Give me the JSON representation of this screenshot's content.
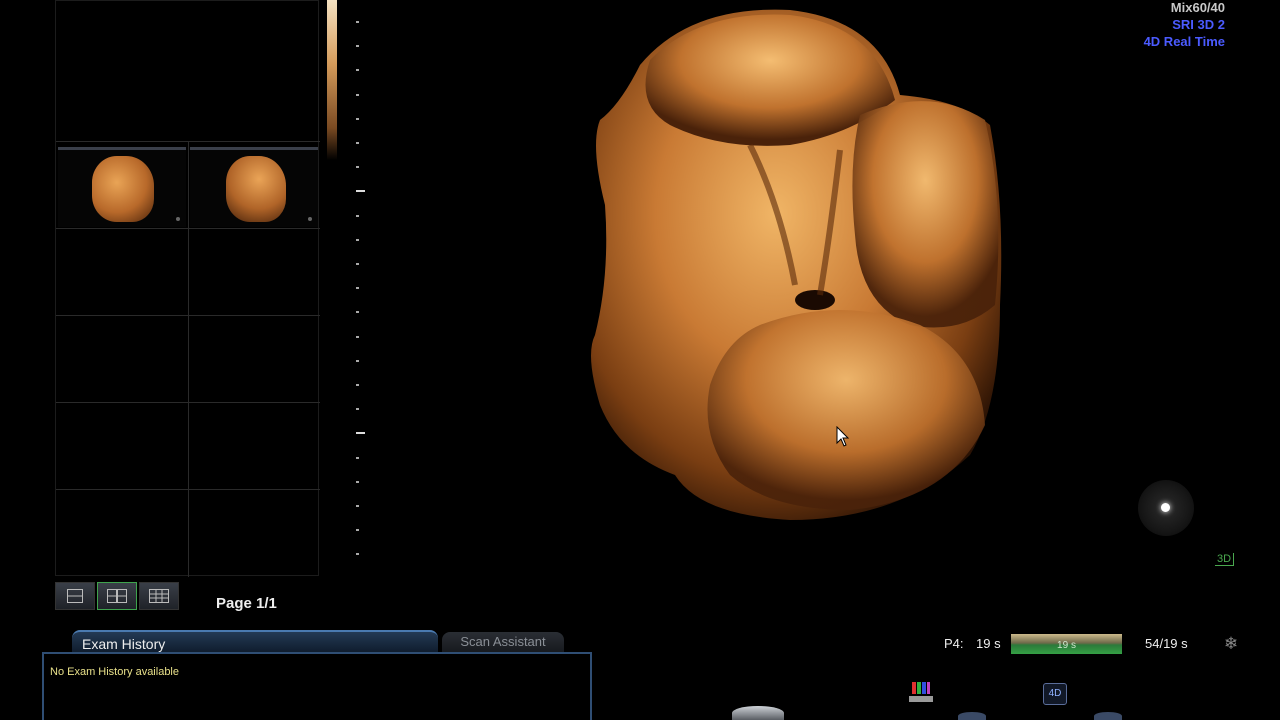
{
  "top_right": {
    "mix": "Mix60/40",
    "sri": "SRI 3D 2",
    "mode": "4D Real Time",
    "mix_color": "#c8c8c8",
    "mode_color": "#4b5bff"
  },
  "layout": {
    "page_label": "Page 1/1",
    "buttons": [
      "single-layout",
      "2x2-layout",
      "3x3-layout"
    ],
    "active_button": "2x2-layout"
  },
  "tabs": {
    "exam_history": "Exam History",
    "scan_assistant": "Scan Assistant",
    "exam_message": "No Exam History available"
  },
  "cine": {
    "preset": "P4:",
    "duration": "19 s",
    "bar_text": "19 s",
    "frames": "54/19 s",
    "progress": 1.0
  },
  "render_label": "3D",
  "fourd_label": "4D",
  "colors": {
    "accent_blue": "#4a7ab0",
    "accent_green": "#3fa34d",
    "skin_tone": "#c97a34"
  }
}
